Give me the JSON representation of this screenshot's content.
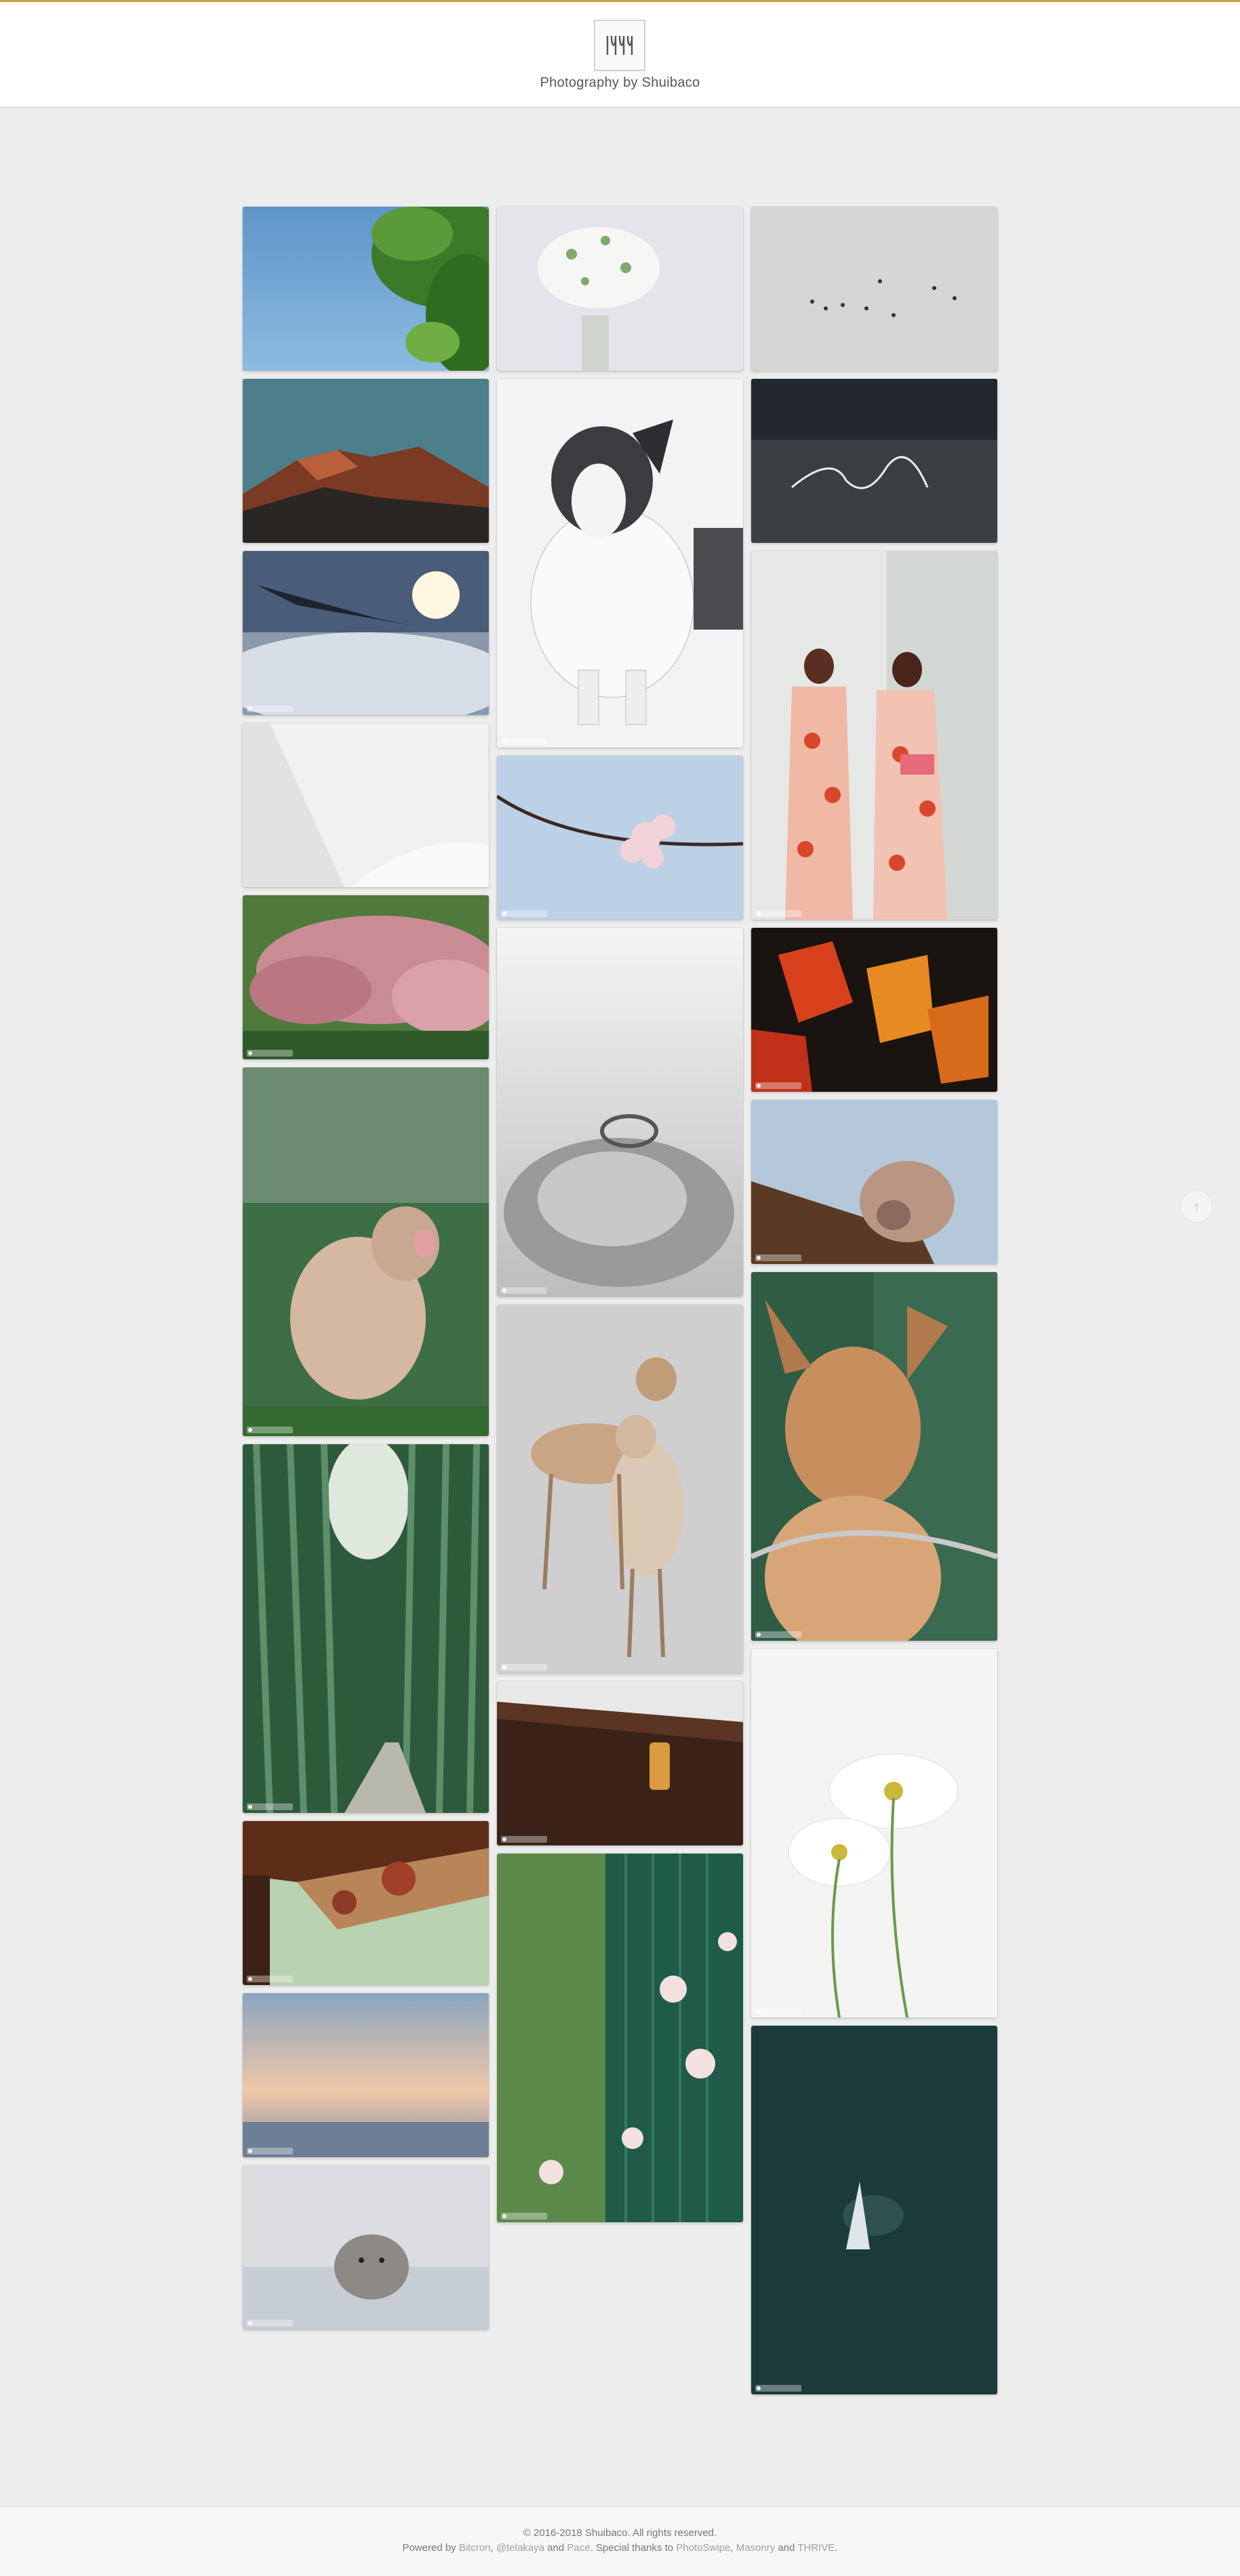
{
  "site": {
    "title": "Photography by Shuibaco"
  },
  "gallery": {
    "photos": [
      {
        "id": "leaves-sky",
        "subject": "green leaves against blue sky"
      },
      {
        "id": "baby-breath",
        "subject": "white flowers in glass"
      },
      {
        "id": "birds",
        "subject": "flock of birds in grey sky"
      },
      {
        "id": "mountain",
        "subject": "mountain at sunset"
      },
      {
        "id": "dog",
        "subject": "dog in snow"
      },
      {
        "id": "light-trails",
        "subject": "light trails at night"
      },
      {
        "id": "airplane",
        "subject": "airplane wing above clouds"
      },
      {
        "id": "kimono",
        "subject": "women in kimono"
      },
      {
        "id": "white-arch",
        "subject": "white architecture"
      },
      {
        "id": "sakura",
        "subject": "cherry blossom branch"
      },
      {
        "id": "pink-trees",
        "subject": "pink blossoming trees"
      },
      {
        "id": "maple",
        "subject": "red maple leaves"
      },
      {
        "id": "rose",
        "subject": "ring on white rose"
      },
      {
        "id": "monkey",
        "subject": "snow monkey"
      },
      {
        "id": "monkey-pipe",
        "subject": "monkey on pipe"
      },
      {
        "id": "deer-pair",
        "subject": "two deer"
      },
      {
        "id": "deer-chain",
        "subject": "deer with chain"
      },
      {
        "id": "bamboo",
        "subject": "bamboo forest path"
      },
      {
        "id": "lantern",
        "subject": "lantern under eaves"
      },
      {
        "id": "cosmos",
        "subject": "white cosmos flowers"
      },
      {
        "id": "porch",
        "subject": "porch with hanging lanterns"
      },
      {
        "id": "flowers-fence",
        "subject": "flowers by green fence"
      },
      {
        "id": "dusk",
        "subject": "dusk sky over water"
      },
      {
        "id": "whale",
        "subject": "whale in dark water"
      },
      {
        "id": "seal",
        "subject": "seal in water"
      }
    ]
  },
  "footer": {
    "copyright": "© 2016-2018 Shuibaco. All rights reserved.",
    "powered_prefix": "Powered by ",
    "hexo": "Bitcron",
    "comma": ", ",
    "author_link": "@telakaya",
    "and1": " and ",
    "theme": "Pace",
    "thanks": ". Special thanks to ",
    "photoswipe": "PhotoSwipe",
    "comma2": ", ",
    "masonry": "Masonry",
    "and2": " and ",
    "thrive": "THRIVE",
    "period": "."
  },
  "controls": {
    "scroll_top_icon": "arrow-up-icon",
    "scroll_top_glyph": "↑"
  },
  "colors": {
    "accent_line": "#c9a14a",
    "page_bg": "#ededed"
  }
}
